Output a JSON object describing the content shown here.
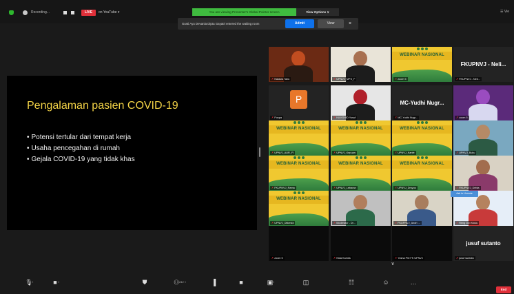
{
  "topbar": {
    "recording_label": "Recording...",
    "live_badge": "LIVE",
    "live_destination": "on YouTube ▾",
    "view_banner": "You are viewing Presenter's Global Pointer screen",
    "view_options": "View Options ∨",
    "right_label": "☰ Vie"
  },
  "waiting_notice": {
    "text": "Gusti Ayu Devania Dipta Gayatri entered the waiting room",
    "admit_label": "Admit",
    "view_label": "View",
    "close_glyph": "×"
  },
  "slide": {
    "title": "Pengalaman pasien COVID-19",
    "bullets": [
      "Potensi tertular dari tempat kerja",
      "Usaha pencegahan di rumah",
      "Gejala COVID-19 yang tidak khas"
    ]
  },
  "gallery": {
    "webinar_title": "WEBINAR NASIONAL",
    "tiles": [
      {
        "name": "Natasia Tanu",
        "kind": "photo"
      },
      {
        "name": "UPNVJ_MPS_F",
        "kind": "photo"
      },
      {
        "name": "zoom 5",
        "kind": "webinar"
      },
      {
        "name": "FKUPNVJ - Neli...",
        "kind": "text"
      },
      {
        "name": "Puspa",
        "kind": "avatar",
        "initial": "P"
      },
      {
        "name": "KA KSHID Yusuf",
        "kind": "photo"
      },
      {
        "name": "MC-Yudhi Nugr...",
        "kind": "text"
      },
      {
        "name": "zoom 5",
        "kind": "photo"
      },
      {
        "name": "UPNVJ_AUR_FI",
        "kind": "webinar"
      },
      {
        "name": "UPNVJ_Kepuan",
        "kind": "webinar"
      },
      {
        "name": "UPNVJ_Kanfe",
        "kind": "webinar"
      },
      {
        "name": "UPNVJ_Buku",
        "kind": "photo"
      },
      {
        "name": "FKUPNVJ_Rama",
        "kind": "webinar"
      },
      {
        "name": "UPNVJ_Lebaran",
        "kind": "webinar"
      },
      {
        "name": "UPNVJ_Drsyoo",
        "kind": "webinar"
      },
      {
        "name": "FKUPNVJ_Debia",
        "kind": "photo"
      },
      {
        "name": "UPNVJ_Ditkesfa",
        "kind": "webinar"
      },
      {
        "name": "Moderator - Dr...",
        "kind": "photo"
      },
      {
        "name": "FKUPNVJ_Andri ...",
        "kind": "photo"
      },
      {
        "name": "Reng Dwi Kdulu",
        "kind": "photo"
      },
      {
        "name": "zoom 5",
        "kind": "dark"
      },
      {
        "name": "Nida Kamila",
        "kind": "dark"
      },
      {
        "name": "Yosha PM FK UPNVJ",
        "kind": "dark"
      },
      {
        "name": "jusuf sutanto",
        "kind": "text"
      }
    ],
    "float_btn": "Ask to Unmute",
    "page_down": "∨"
  },
  "toolbar": {
    "items": [
      {
        "name": "mic-icon",
        "glyph": "🎙",
        "cnt": "˄"
      },
      {
        "name": "video-icon",
        "glyph": "■",
        "cnt": "˄"
      },
      {
        "name": "security-icon",
        "glyph": "⛊",
        "cnt": ""
      },
      {
        "name": "participants-icon",
        "glyph": "⚇",
        "cnt": "242 ˄"
      },
      {
        "name": "polls-icon",
        "glyph": "▐",
        "cnt": ""
      },
      {
        "name": "chat-icon",
        "glyph": "■",
        "cnt": ""
      },
      {
        "name": "share-screen-icon",
        "glyph": "▣",
        "cnt": "˄"
      },
      {
        "name": "breakout-icon",
        "glyph": "◫",
        "cnt": ""
      },
      {
        "name": "apps-icon",
        "glyph": "☷",
        "cnt": ""
      },
      {
        "name": "reactions-icon",
        "glyph": "☺",
        "cnt": ""
      },
      {
        "name": "more-icon",
        "glyph": "…",
        "cnt": ""
      }
    ],
    "end_label": "End"
  }
}
